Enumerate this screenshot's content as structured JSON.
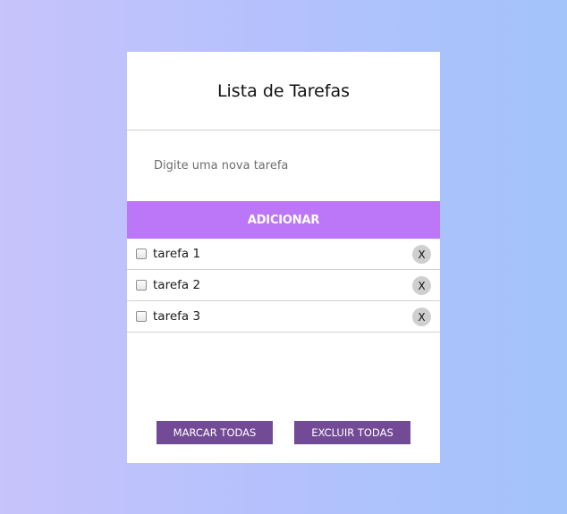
{
  "header": {
    "title": "Lista de Tarefas"
  },
  "new_task": {
    "placeholder": "Digite uma nova tarefa",
    "value": ""
  },
  "add_button": {
    "label": "ADICIONAR"
  },
  "tasks": [
    {
      "label": "tarefa 1",
      "checked": false,
      "delete_label": "X"
    },
    {
      "label": "tarefa 2",
      "checked": false,
      "delete_label": "X"
    },
    {
      "label": "tarefa 3",
      "checked": false,
      "delete_label": "X"
    }
  ],
  "footer": {
    "mark_all_label": "MARCAR TODAS",
    "delete_all_label": "EXCLUIR TODAS"
  },
  "colors": {
    "accent": "#bb77f7",
    "footer_button": "#734a96",
    "background_start": "#c7c3fb",
    "background_end": "#a3c3fb"
  }
}
